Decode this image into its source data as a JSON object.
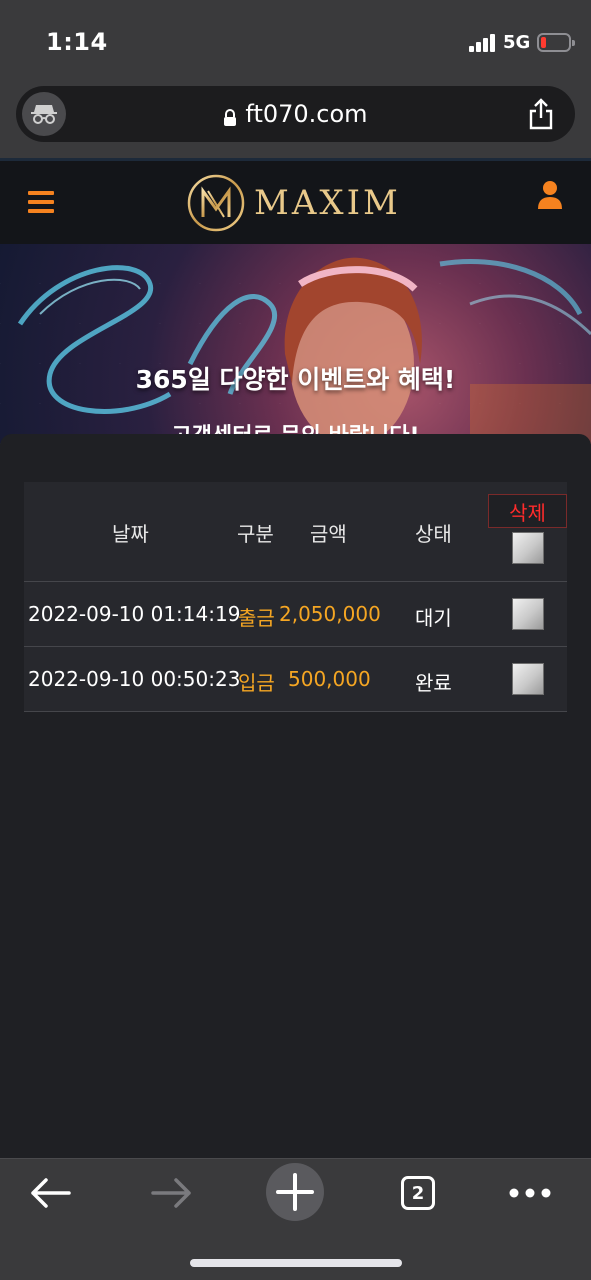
{
  "status_bar": {
    "time": "1:14",
    "network": "5G",
    "battery_color": "#ff3b30"
  },
  "browser": {
    "url": "ft070.com",
    "mode_icon": "incognito-icon",
    "share_icon": "share-icon"
  },
  "site_header": {
    "menu_icon": "hamburger-menu-icon",
    "logo_text": "MAXIM",
    "user_icon": "user-icon",
    "accent_color": "#f5821f"
  },
  "banner": {
    "title": "365일 다양한 이벤트와 혜택!",
    "subtitle": "고객센터로 문의 바랍니다!"
  },
  "history_table": {
    "delete_label": "삭제",
    "columns": {
      "date": "날짜",
      "type": "구분",
      "amount": "금액",
      "status": "상태"
    },
    "rows": [
      {
        "date": "2022-09-10 01:14:19",
        "type": "출금",
        "amount": "2,050,000",
        "status": "대기",
        "checked": false
      },
      {
        "date": "2022-09-10 00:50:23",
        "type": "입금",
        "amount": "500,000",
        "status": "완료",
        "checked": false
      }
    ],
    "highlight_color": "#f5a623",
    "delete_color": "#ff2b2b"
  },
  "toolbar": {
    "back_icon": "back-arrow-icon",
    "forward_icon": "forward-arrow-icon",
    "new_tab_icon": "plus-icon",
    "tab_count": "2",
    "more_icon": "more-dots-icon"
  }
}
